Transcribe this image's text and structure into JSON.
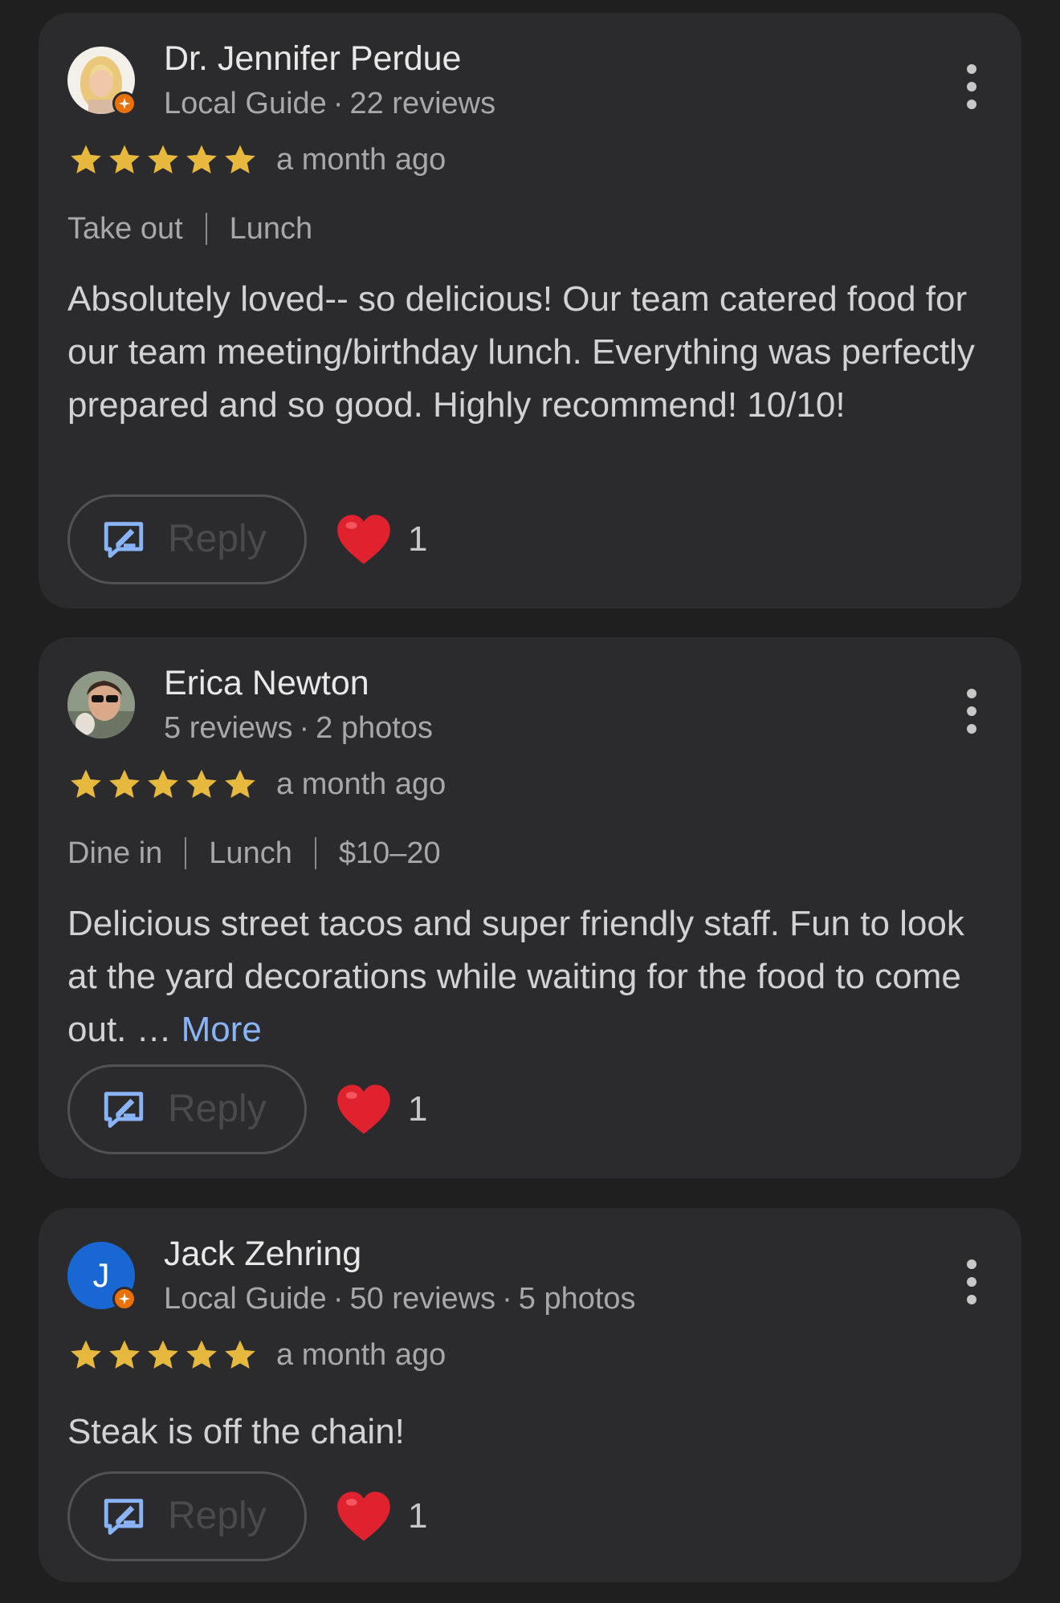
{
  "reviews": [
    {
      "name": "Dr. Jennifer Perdue",
      "meta": [
        "Local Guide",
        "22 reviews"
      ],
      "local_guide": true,
      "avatar": "photo-blonde-woman",
      "rating": 5,
      "time": "a month ago",
      "tags": [
        "Take out",
        "Lunch"
      ],
      "text": "Absolutely loved-- so delicious! Our team catered food for our team meeting/birthday lunch. Everything was perfectly prepared and so good. Highly recommend! 10/10!",
      "more_label": "",
      "reply_label": "Reply",
      "likes": "1"
    },
    {
      "name": "Erica Newton",
      "meta": [
        "5 reviews",
        "2 photos"
      ],
      "local_guide": false,
      "avatar": "photo-woman-sunglasses",
      "rating": 5,
      "time": "a month ago",
      "tags": [
        "Dine in",
        "Lunch",
        "$10–20"
      ],
      "text": "Delicious street tacos and super friendly staff. Fun to look at the yard decorations while waiting for the food to come out. …",
      "more_label": "More",
      "reply_label": "Reply",
      "likes": "1"
    },
    {
      "name": "Jack Zehring",
      "meta": [
        "Local Guide",
        "50 reviews",
        "5 photos"
      ],
      "local_guide": true,
      "avatar_letter": "J",
      "rating": 5,
      "time": "a month ago",
      "tags": [],
      "text": "Steak is off the chain!",
      "more_label": "",
      "reply_label": "Reply",
      "likes": "1"
    }
  ],
  "colors": {
    "star": "#e6b93e",
    "accent_link": "#8ab4f8",
    "reply_icon": "#8ab4f8",
    "heart": "#e0222f",
    "guide_badge": "#e8710a",
    "letter_avatar_bg": "#1967d2"
  },
  "icons": {
    "reply": "reply-edit-icon",
    "like": "heart-icon",
    "menu": "more-vert-icon",
    "star": "star-icon",
    "guide": "local-guide-badge-icon"
  }
}
